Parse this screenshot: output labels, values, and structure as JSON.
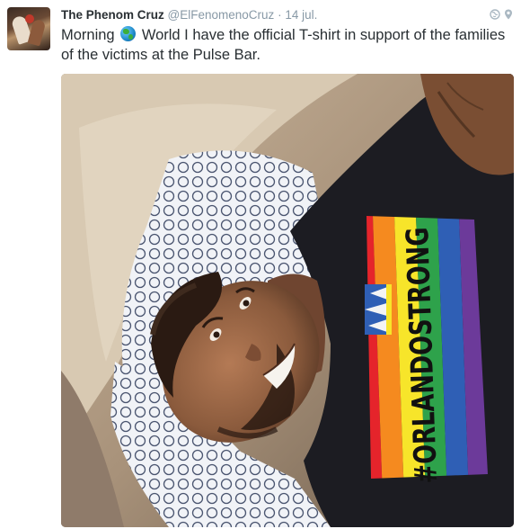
{
  "tweet": {
    "author_name": "The Phenom Cruz",
    "author_handle": "@ElFenomenoCruz",
    "separator": "·",
    "timestamp": "14 jul.",
    "text_before_emoji": "Morning",
    "emoji": "globe-emoji",
    "text_after_emoji": "World I have the official T-shirt in support of the families of the victims at the Pulse Bar.",
    "icons": [
      "globe-icon",
      "location-pin-icon"
    ]
  },
  "photo": {
    "shirt_text": "#ORLANDOSTRONG",
    "colors": {
      "shirt": "#1c1c22",
      "flag_red": "#e5242b",
      "flag_orange": "#f58a1f",
      "flag_yellow": "#f7e52a",
      "flag_green": "#2ea24b",
      "flag_blue": "#2f5fb5",
      "flag_purple": "#6c3a9a"
    }
  }
}
